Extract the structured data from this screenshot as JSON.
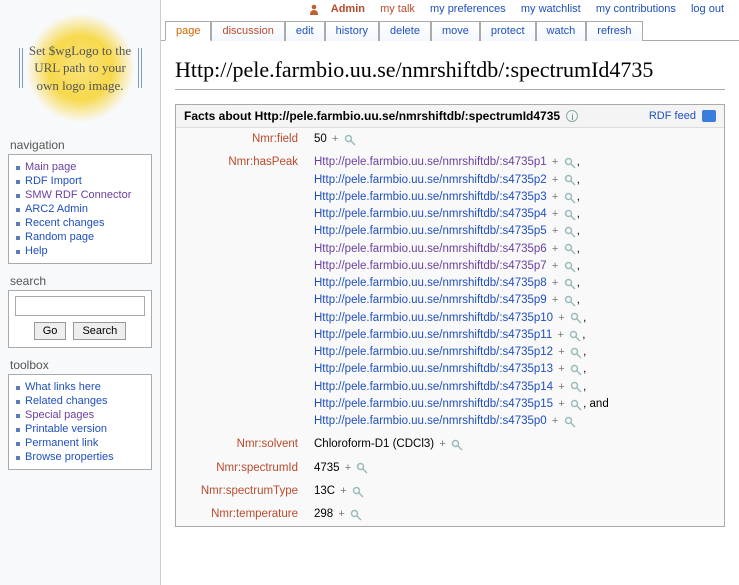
{
  "topnav": {
    "admin": "Admin",
    "mytalk": "my talk",
    "mypreferences": "my preferences",
    "mywatchlist": "my watchlist",
    "mycontributions": "my contributions",
    "logout": "log out"
  },
  "tabs": {
    "page": "page",
    "discussion": "discussion",
    "edit": "edit",
    "history": "history",
    "delete": "delete",
    "move": "move",
    "protect": "protect",
    "watch": "watch",
    "refresh": "refresh"
  },
  "logo_text": "Set $wgLogo to the URL path to your own logo image.",
  "sidebar": {
    "navigation": {
      "heading": "navigation",
      "items": [
        "Main page",
        "RDF Import",
        "SMW RDF Connector",
        "ARC2 Admin",
        "Recent changes",
        "Random page",
        "Help"
      ]
    },
    "search": {
      "heading": "search",
      "go": "Go",
      "search": "Search"
    },
    "toolbox": {
      "heading": "toolbox",
      "items": [
        "What links here",
        "Related changes",
        "Special pages",
        "Printable version",
        "Permanent link",
        "Browse properties"
      ]
    }
  },
  "title": "Http://pele.farmbio.uu.se/nmrshiftdb/:spectrumId4735",
  "factbox": {
    "header": "Facts about Http://pele.farmbio.uu.se/nmrshiftdb/:spectrumId4735",
    "rdf_feed": "RDF feed",
    "rows": {
      "field": {
        "prop": "Nmr:field",
        "value": "50"
      },
      "hasPeak": {
        "prop": "Nmr:hasPeak",
        "peaks": [
          {
            "text": "Http://pele.farmbio.uu.se/nmrshiftdb/:s4735p1",
            "visited": true,
            "suffix": ","
          },
          {
            "text": "Http://pele.farmbio.uu.se/nmrshiftdb/:s4735p2",
            "visited": false,
            "suffix": ","
          },
          {
            "text": "Http://pele.farmbio.uu.se/nmrshiftdb/:s4735p3",
            "visited": false,
            "suffix": ","
          },
          {
            "text": "Http://pele.farmbio.uu.se/nmrshiftdb/:s4735p4",
            "visited": false,
            "suffix": ","
          },
          {
            "text": "Http://pele.farmbio.uu.se/nmrshiftdb/:s4735p5",
            "visited": false,
            "suffix": ","
          },
          {
            "text": "Http://pele.farmbio.uu.se/nmrshiftdb/:s4735p6",
            "visited": true,
            "suffix": ","
          },
          {
            "text": "Http://pele.farmbio.uu.se/nmrshiftdb/:s4735p7",
            "visited": true,
            "suffix": ","
          },
          {
            "text": "Http://pele.farmbio.uu.se/nmrshiftdb/:s4735p8",
            "visited": false,
            "suffix": ","
          },
          {
            "text": "Http://pele.farmbio.uu.se/nmrshiftdb/:s4735p9",
            "visited": false,
            "suffix": ","
          },
          {
            "text": "Http://pele.farmbio.uu.se/nmrshiftdb/:s4735p10",
            "visited": false,
            "suffix": ","
          },
          {
            "text": "Http://pele.farmbio.uu.se/nmrshiftdb/:s4735p11",
            "visited": false,
            "suffix": ","
          },
          {
            "text": "Http://pele.farmbio.uu.se/nmrshiftdb/:s4735p12",
            "visited": false,
            "suffix": ","
          },
          {
            "text": "Http://pele.farmbio.uu.se/nmrshiftdb/:s4735p13",
            "visited": false,
            "suffix": ","
          },
          {
            "text": "Http://pele.farmbio.uu.se/nmrshiftdb/:s4735p14",
            "visited": false,
            "suffix": ","
          },
          {
            "text": "Http://pele.farmbio.uu.se/nmrshiftdb/:s4735p15",
            "visited": false,
            "suffix": ", and"
          },
          {
            "text": "Http://pele.farmbio.uu.se/nmrshiftdb/:s4735p0",
            "visited": false,
            "suffix": ""
          }
        ]
      },
      "solvent": {
        "prop": "Nmr:solvent",
        "value": "Chloroform-D1 (CDCl3)"
      },
      "spectrumId": {
        "prop": "Nmr:spectrumId",
        "value": "4735"
      },
      "spectrumType": {
        "prop": "Nmr:spectrumType",
        "value": "13C"
      },
      "temperature": {
        "prop": "Nmr:temperature",
        "value": "298"
      }
    }
  }
}
